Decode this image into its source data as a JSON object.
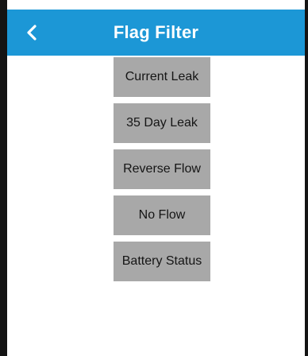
{
  "header": {
    "title": "Flag Filter",
    "back_icon": "chevron-left-icon",
    "background_color": "#1c97d6"
  },
  "filters": [
    {
      "label": "Current Leak"
    },
    {
      "label": "35 Day Leak"
    },
    {
      "label": "Reverse Flow"
    },
    {
      "label": "No Flow"
    },
    {
      "label": "Battery Status"
    }
  ]
}
